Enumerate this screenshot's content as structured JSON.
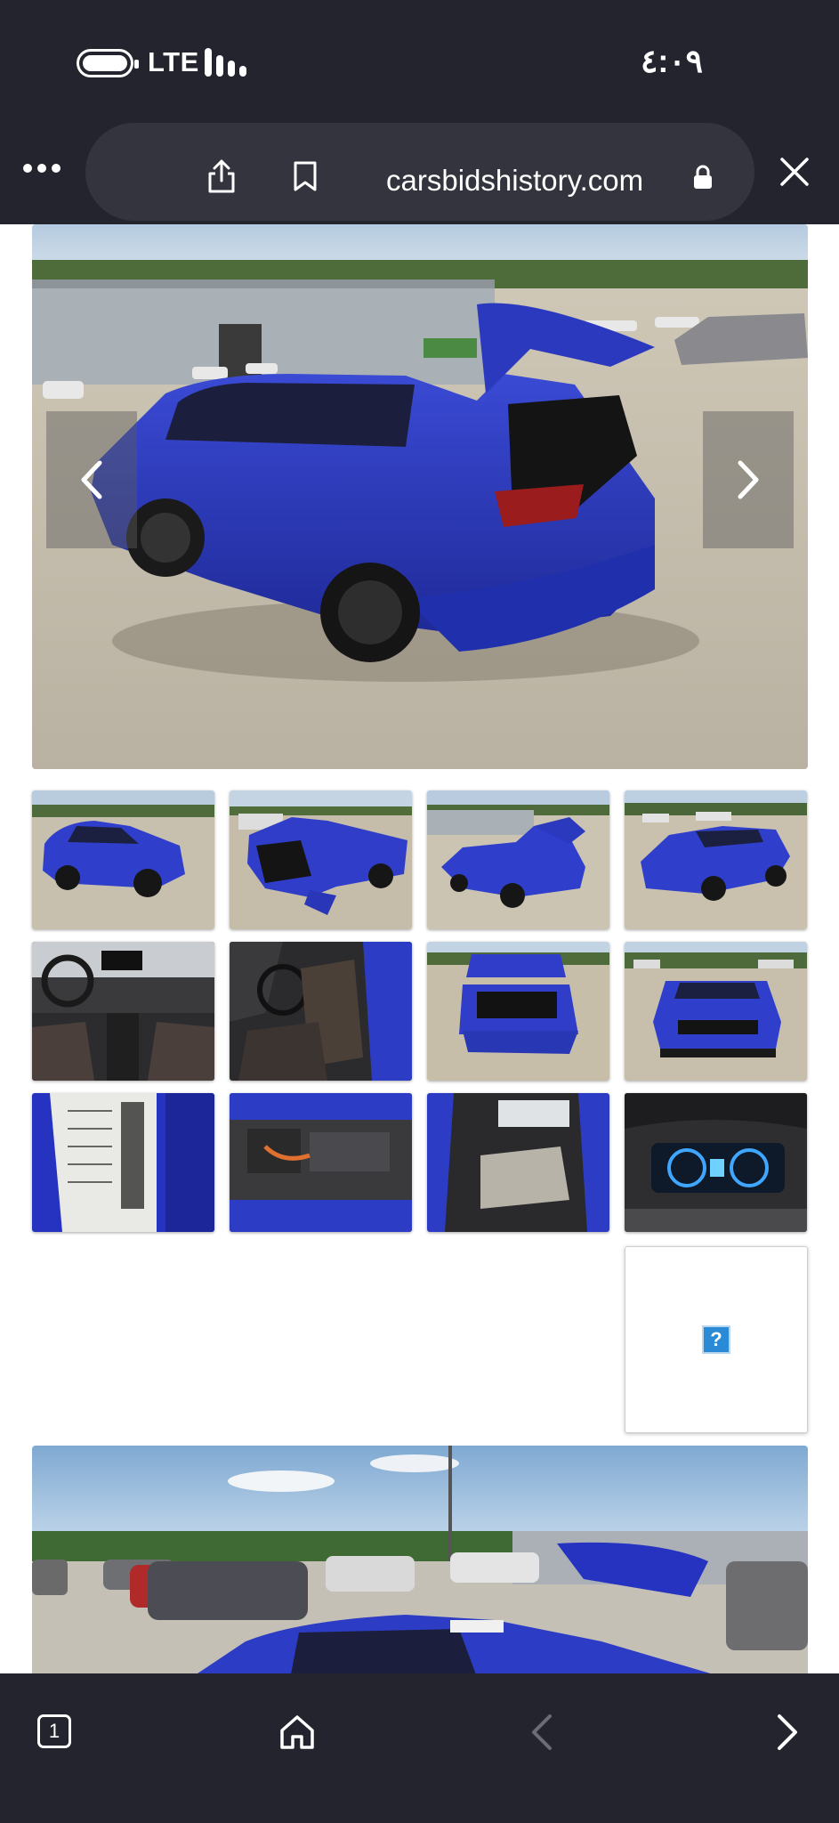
{
  "status_bar": {
    "network": "LTE",
    "time": "٤:٠٩"
  },
  "browser": {
    "url": "carsbidshistory.com",
    "tab_count": "1"
  },
  "gallery": {
    "main_image": "blue-sedan-rear-damage-photo",
    "thumbnails": [
      "front-left-view",
      "rear-damage-view",
      "rear-left-view",
      "front-right-view",
      "dashboard-interior",
      "front-seats-interior",
      "open-trunk-rear",
      "front-grille-view",
      "door-label-sticker",
      "engine-bay",
      "rear-seats-interior",
      "instrument-cluster"
    ],
    "missing_image_glyph": "?",
    "bottom_image": "lot-front-view-with-cars"
  },
  "icons": [
    "battery-icon",
    "signal-icon",
    "more-icon",
    "share-icon",
    "bookmark-icon",
    "lock-icon",
    "close-icon",
    "prev-arrow-icon",
    "next-arrow-icon",
    "tabs-icon",
    "home-icon",
    "back-icon",
    "forward-icon"
  ],
  "colors": {
    "chrome": "#24242e",
    "url_pill": "#34343e",
    "car_blue": "#2d3cc4"
  }
}
